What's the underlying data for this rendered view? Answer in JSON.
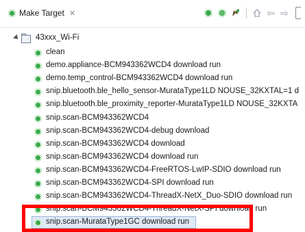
{
  "view": {
    "tab_title": "Make Target",
    "tab_close_glyph": "✕"
  },
  "toolbar": {
    "icons": [
      "build-target-icon",
      "new-target-icon",
      "tools-icon",
      "home-icon",
      "back-arrow-icon",
      "forward-arrow-icon",
      "collapse-icon"
    ]
  },
  "tree": {
    "root": {
      "label": "43xxx_Wi-Fi",
      "icon": "folder-icon"
    },
    "items": [
      {
        "label": "clean"
      },
      {
        "label": "demo.appliance-BCM943362WCD4 download run"
      },
      {
        "label": "demo.temp_control-BCM943362WCD4 download run"
      },
      {
        "label": "snip.bluetooth.ble_hello_sensor-MurataType1LD NOUSE_32KXTAL=1 d"
      },
      {
        "label": "snip.bluetooth.ble_proximity_reporter-MurataType1LD NOUSE_32KXTA"
      },
      {
        "label": "snip.scan-BCM943362WCD4"
      },
      {
        "label": "snip.scan-BCM943362WCD4-debug download"
      },
      {
        "label": "snip.scan-BCM943362WCD4 download"
      },
      {
        "label": "snip.scan-BCM943362WCD4 download run"
      },
      {
        "label": "snip.scan-BCM943362WCD4-FreeRTOS-LwIP-SDIO download run"
      },
      {
        "label": "snip.scan-BCM943362WCD4-SPI download run"
      },
      {
        "label": "snip.scan-BCM943362WCD4-ThreadX-NetX_Duo-SDIO download run"
      },
      {
        "label": "snip.scan-BCM943362WCD4-ThreadX-NetX-SPI download run"
      },
      {
        "label": "snip.scan-MurataType1GC download run",
        "selected": true
      }
    ]
  },
  "colors": {
    "target_icon": "#3aaa4b",
    "selection_bg": "#dfe9f6",
    "highlight_box": "#ff0000"
  }
}
